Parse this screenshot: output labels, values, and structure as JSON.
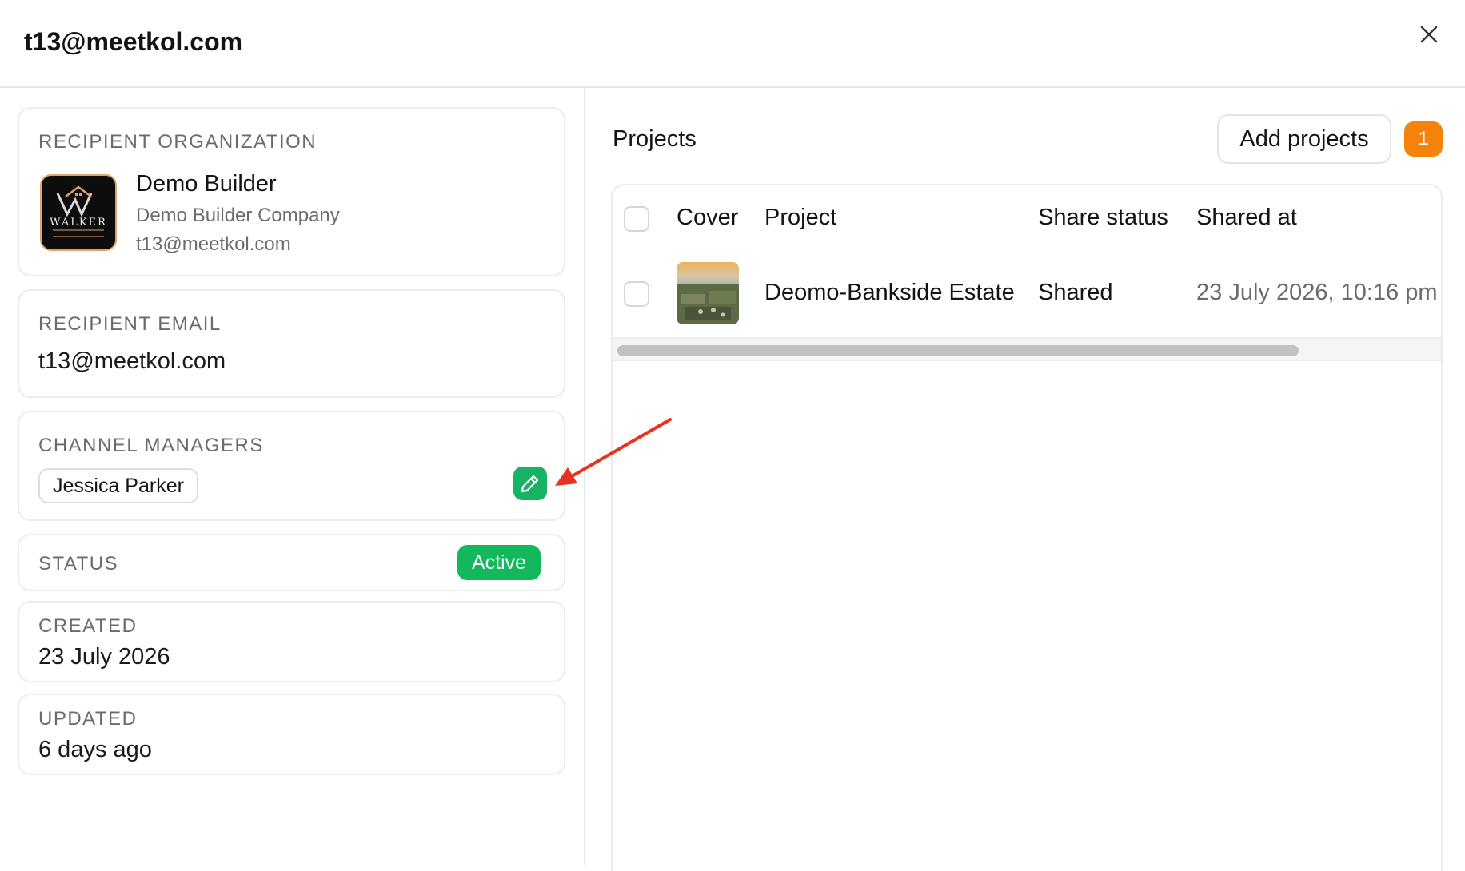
{
  "header": {
    "title": "t13@meetkol.com",
    "close_icon": "close-icon"
  },
  "recipient_organization": {
    "label": "RECIPIENT ORGANIZATION",
    "name": "Demo Builder",
    "company": "Demo Builder Company",
    "email": "t13@meetkol.com",
    "logo_text": "WALKER"
  },
  "recipient_email": {
    "label": "RECIPIENT EMAIL",
    "value": "t13@meetkol.com"
  },
  "channel_managers": {
    "label": "CHANNEL MANAGERS",
    "managers": [
      "Jessica Parker"
    ],
    "edit_icon": "pencil-icon"
  },
  "status": {
    "label": "STATUS",
    "value": "Active",
    "color": "#12b85b"
  },
  "created": {
    "label": "CREATED",
    "value": "23 July 2026"
  },
  "updated": {
    "label": "UPDATED",
    "value": "6 days ago"
  },
  "projects": {
    "title": "Projects",
    "add_button": "Add projects",
    "count": "1",
    "count_color": "#f5820b",
    "columns": [
      "Cover",
      "Project",
      "Share status",
      "Shared at"
    ],
    "rows": [
      {
        "project": "Deomo-Bankside Estate",
        "share_status": "Shared",
        "shared_at": "23 July 2026, 10:16 pm"
      }
    ]
  },
  "annotation": {
    "color": "#e8321f"
  }
}
